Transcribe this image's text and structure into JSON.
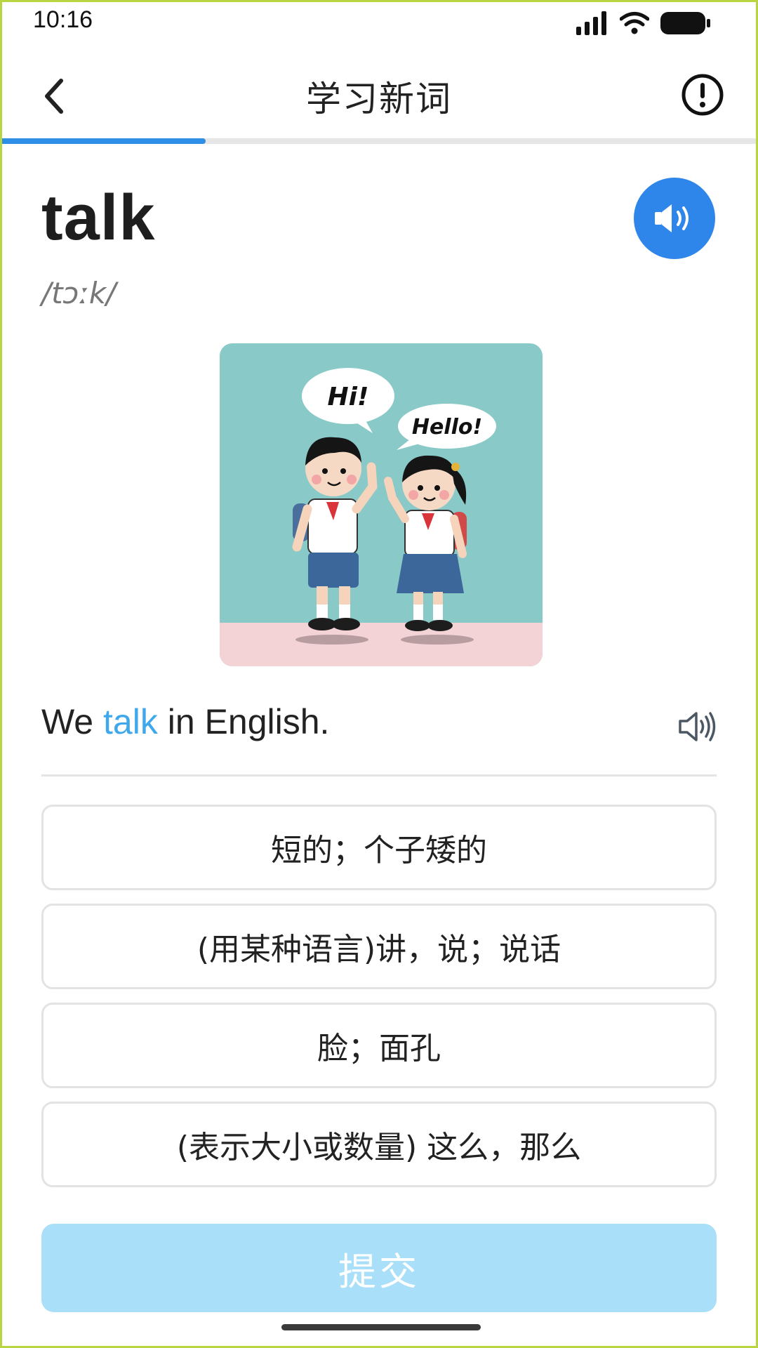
{
  "status_bar": {
    "time": "10:16"
  },
  "header": {
    "title": "学习新词",
    "back_icon": "chevron-left-icon",
    "report_icon": "exclamation-circle-icon"
  },
  "progress": {
    "fraction": 0.27,
    "fill_color": "#2f8fe6"
  },
  "word": {
    "text": "talk",
    "phonetic": "/tɔːk/"
  },
  "illustration": {
    "bubble_left": "Hi!",
    "bubble_right": "Hello!"
  },
  "example": {
    "before": "We",
    "highlight": "talk",
    "after": "in English."
  },
  "options": [
    {
      "label": "短的；个子矮的"
    },
    {
      "label": "(用某种语言)讲，说；说话"
    },
    {
      "label": "脸；面孔"
    },
    {
      "label": "(表示大小或数量) 这么，那么"
    }
  ],
  "submit": {
    "label": "提交"
  },
  "colors": {
    "accent": "#2f86ea",
    "highlight": "#3fa8ec",
    "submit_disabled": "#a9dff8"
  }
}
